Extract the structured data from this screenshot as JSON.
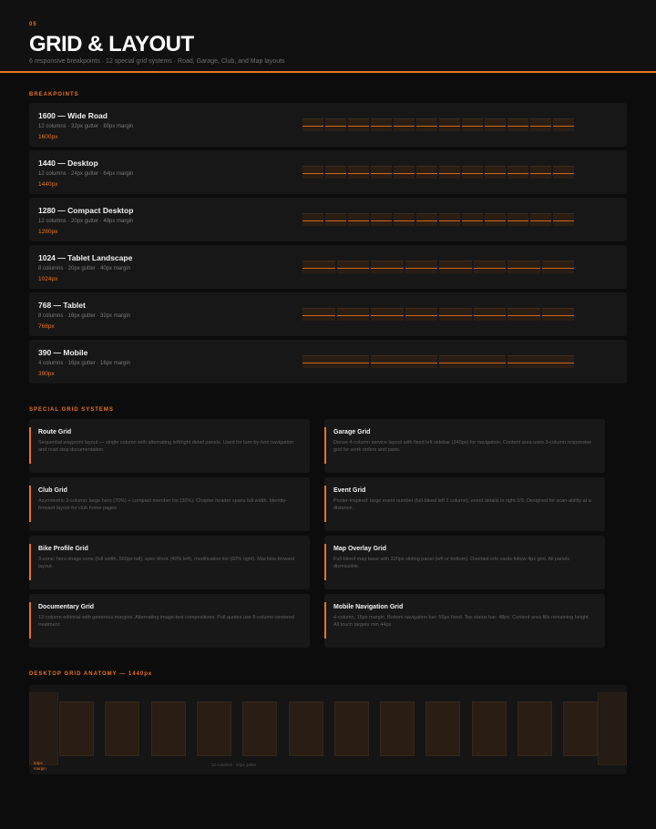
{
  "header": {
    "section_number": "05",
    "title": "GRID & LAYOUT",
    "subtitle": "6 responsive breakpoints · 12 special grid systems · Road, Garage, Club, and Map layouts"
  },
  "breakpoints": {
    "label": "BREAKPOINTS",
    "items": [
      {
        "name": "1600 — Wide Road",
        "spec": "12 columns · 32px gutter · 80px margin",
        "px": "1600px",
        "columns": 12
      },
      {
        "name": "1440 — Desktop",
        "spec": "12 columns · 24px gutter · 64px margin",
        "px": "1440px",
        "columns": 12
      },
      {
        "name": "1280 — Compact Desktop",
        "spec": "12 columns · 20px gutter · 48px margin",
        "px": "1280px",
        "columns": 12
      },
      {
        "name": "1024 — Tablet Landscape",
        "spec": "8 columns · 20px gutter · 40px margin",
        "px": "1024px",
        "columns": 8
      },
      {
        "name": "768 — Tablet",
        "spec": "8 columns · 16px gutter · 32px margin",
        "px": "768px",
        "columns": 8
      },
      {
        "name": "390 — Mobile",
        "spec": "4 columns · 16px gutter · 16px margin",
        "px": "390px",
        "columns": 4
      }
    ]
  },
  "special_grids": {
    "label": "SPECIAL GRID SYSTEMS",
    "items": [
      {
        "title": "Route Grid",
        "desc": "Sequential waypoint layout — single column with alternating left/right detail panels. Used for turn-by-turn navigation and road stop documentation."
      },
      {
        "title": "Garage Grid",
        "desc": "Dense 4-column service layout with fixed left sidebar (240px) for navigation. Content area uses 3-column responsive grid for work orders and parts."
      },
      {
        "title": "Club Grid",
        "desc": "Asymmetric 2-column: large hero (70%) + compact member list (30%). Chapter header spans full width. Identity-forward layout for club home pages."
      },
      {
        "title": "Event Grid",
        "desc": "Poster-inspired: large event number (full-bleed left 1 column), event details in right 2/3. Designed for scan-ability at a distance."
      },
      {
        "title": "Bike Profile Grid",
        "desc": "3-zone: hero image zone (full width, 560px tall), spec block (40% left), modification list (60% right). Machine-forward layout."
      },
      {
        "title": "Map Overlay Grid",
        "desc": "Full-bleed map base with 320px sliding panel (left or bottom). Overlaid info cards follow 4px grid. All panels dismissible."
      },
      {
        "title": "Documentary Grid",
        "desc": "12-column editorial with generous margins. Alternating image-text compositions. Pull quotes use 8-column centered treatment."
      },
      {
        "title": "Mobile Navigation Grid",
        "desc": "4-column, 16px margin. Bottom navigation bar: 56px fixed. Top status bar: 48px. Content area fills remaining height. All touch targets min 44px."
      }
    ]
  },
  "anatomy": {
    "label": "DESKTOP GRID ANATOMY — 1440px",
    "margin_label_line1": "64px",
    "margin_label_line2": "margin",
    "caption": "12 columns · 24px gutter",
    "columns": 12
  },
  "colors": {
    "accent": "#e8731f",
    "background": "#0c0c0c",
    "card": "#171717"
  }
}
